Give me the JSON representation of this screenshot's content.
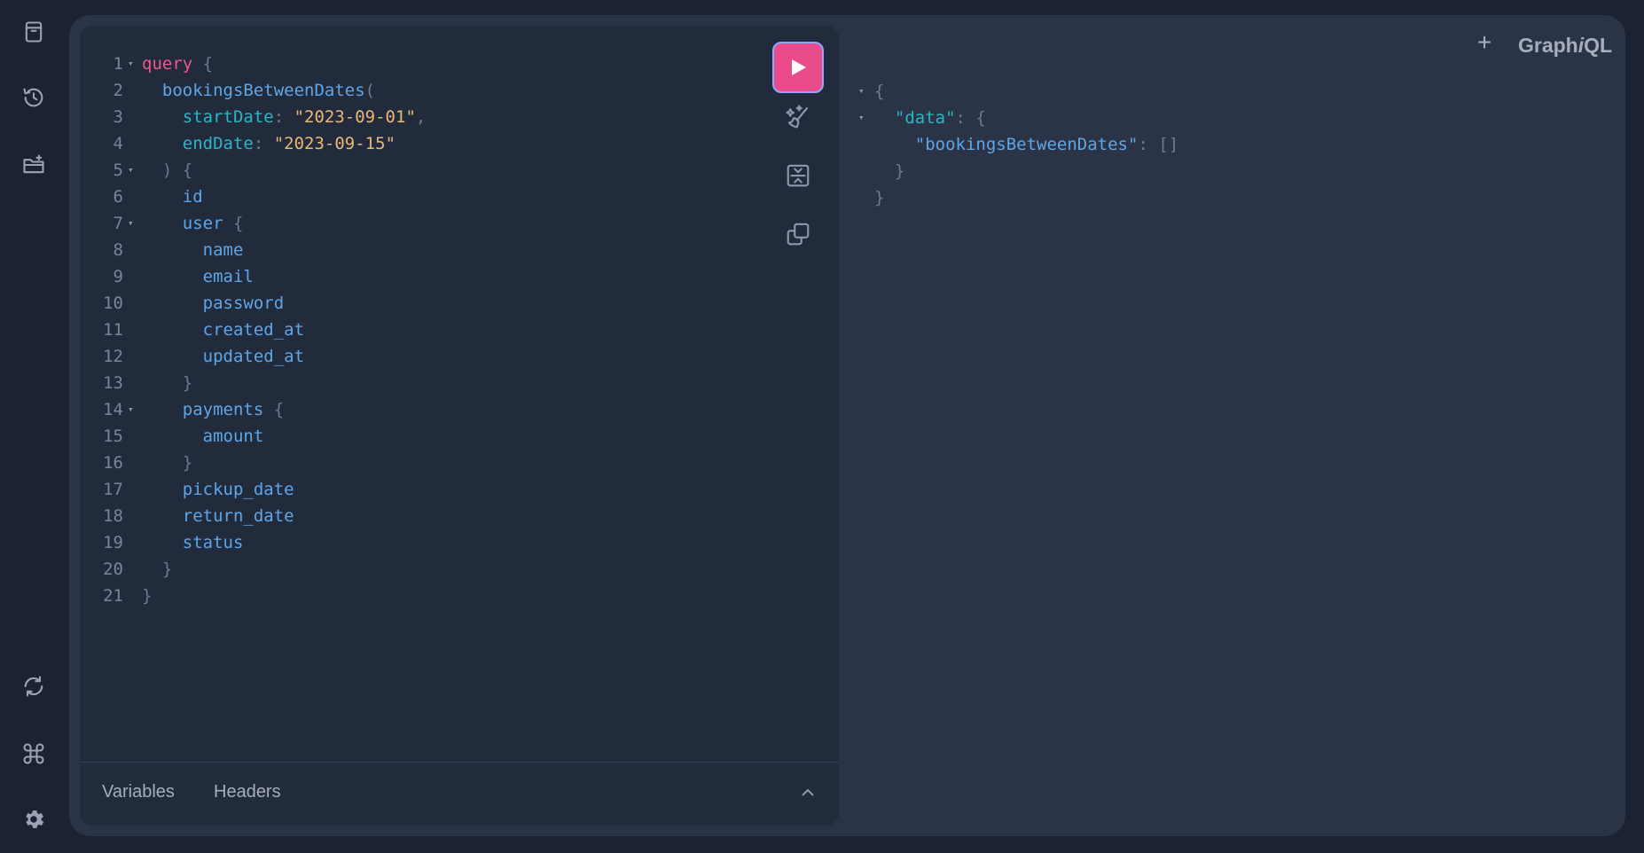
{
  "app": {
    "logo_prefix": "Graph",
    "logo_italic": "i",
    "logo_suffix": "QL",
    "new_tab": "+"
  },
  "sidebar": {
    "top": [
      {
        "icon": "docs-icon"
      },
      {
        "icon": "history-icon"
      },
      {
        "icon": "add-folder-icon"
      }
    ],
    "bottom": [
      {
        "icon": "refetch-schema-icon"
      },
      {
        "icon": "keyboard-shortcuts-icon"
      },
      {
        "icon": "settings-icon"
      }
    ]
  },
  "editor": {
    "lines": [
      [
        [
          "kw",
          "query"
        ],
        [
          "p",
          " {"
        ]
      ],
      [
        [
          "p",
          "  "
        ],
        [
          "fn",
          "bookingsBetweenDates"
        ],
        [
          "p",
          "("
        ]
      ],
      [
        [
          "p",
          "    "
        ],
        [
          "arg",
          "startDate"
        ],
        [
          "p",
          ": "
        ],
        [
          "str",
          "\"2023-09-01\""
        ],
        [
          "p",
          ","
        ]
      ],
      [
        [
          "p",
          "    "
        ],
        [
          "arg",
          "endDate"
        ],
        [
          "p",
          ": "
        ],
        [
          "str",
          "\"2023-09-15\""
        ]
      ],
      [
        [
          "p",
          "  ) {"
        ]
      ],
      [
        [
          "p",
          "    "
        ],
        [
          "fn",
          "id"
        ]
      ],
      [
        [
          "p",
          "    "
        ],
        [
          "fn",
          "user"
        ],
        [
          "p",
          " {"
        ]
      ],
      [
        [
          "p",
          "      "
        ],
        [
          "fn",
          "name"
        ]
      ],
      [
        [
          "p",
          "      "
        ],
        [
          "fn",
          "email"
        ]
      ],
      [
        [
          "p",
          "      "
        ],
        [
          "fn",
          "password"
        ]
      ],
      [
        [
          "p",
          "      "
        ],
        [
          "fn",
          "created_at"
        ]
      ],
      [
        [
          "p",
          "      "
        ],
        [
          "fn",
          "updated_at"
        ]
      ],
      [
        [
          "p",
          "    }"
        ]
      ],
      [
        [
          "p",
          "    "
        ],
        [
          "fn",
          "payments"
        ],
        [
          "p",
          " {"
        ]
      ],
      [
        [
          "p",
          "      "
        ],
        [
          "fn",
          "amount"
        ]
      ],
      [
        [
          "p",
          "    }"
        ]
      ],
      [
        [
          "p",
          "    "
        ],
        [
          "fn",
          "pickup_date"
        ]
      ],
      [
        [
          "p",
          "    "
        ],
        [
          "fn",
          "return_date"
        ]
      ],
      [
        [
          "p",
          "    "
        ],
        [
          "fn",
          "status"
        ]
      ],
      [
        [
          "p",
          "  }"
        ]
      ],
      [
        [
          "p",
          "}"
        ]
      ]
    ],
    "folds": [
      1,
      5,
      7,
      14
    ],
    "fold_glyph": "▾",
    "toolbar": [
      "prettify-icon",
      "merge-fragments-icon",
      "copy-icon"
    ],
    "run_button": "play-icon",
    "bottom_tabs": [
      "Variables",
      "Headers"
    ]
  },
  "result": {
    "lines": [
      [
        [
          "p",
          "{"
        ]
      ],
      [
        [
          "p",
          "  "
        ],
        [
          "rkey",
          "\"data\""
        ],
        [
          "p",
          ": {"
        ]
      ],
      [
        [
          "p",
          "    "
        ],
        [
          "rkey2",
          "\"bookingsBetweenDates\""
        ],
        [
          "p",
          ": []"
        ]
      ],
      [
        [
          "p",
          "  }"
        ]
      ],
      [
        [
          "p",
          "}"
        ]
      ]
    ],
    "folds": [
      1,
      2
    ]
  }
}
